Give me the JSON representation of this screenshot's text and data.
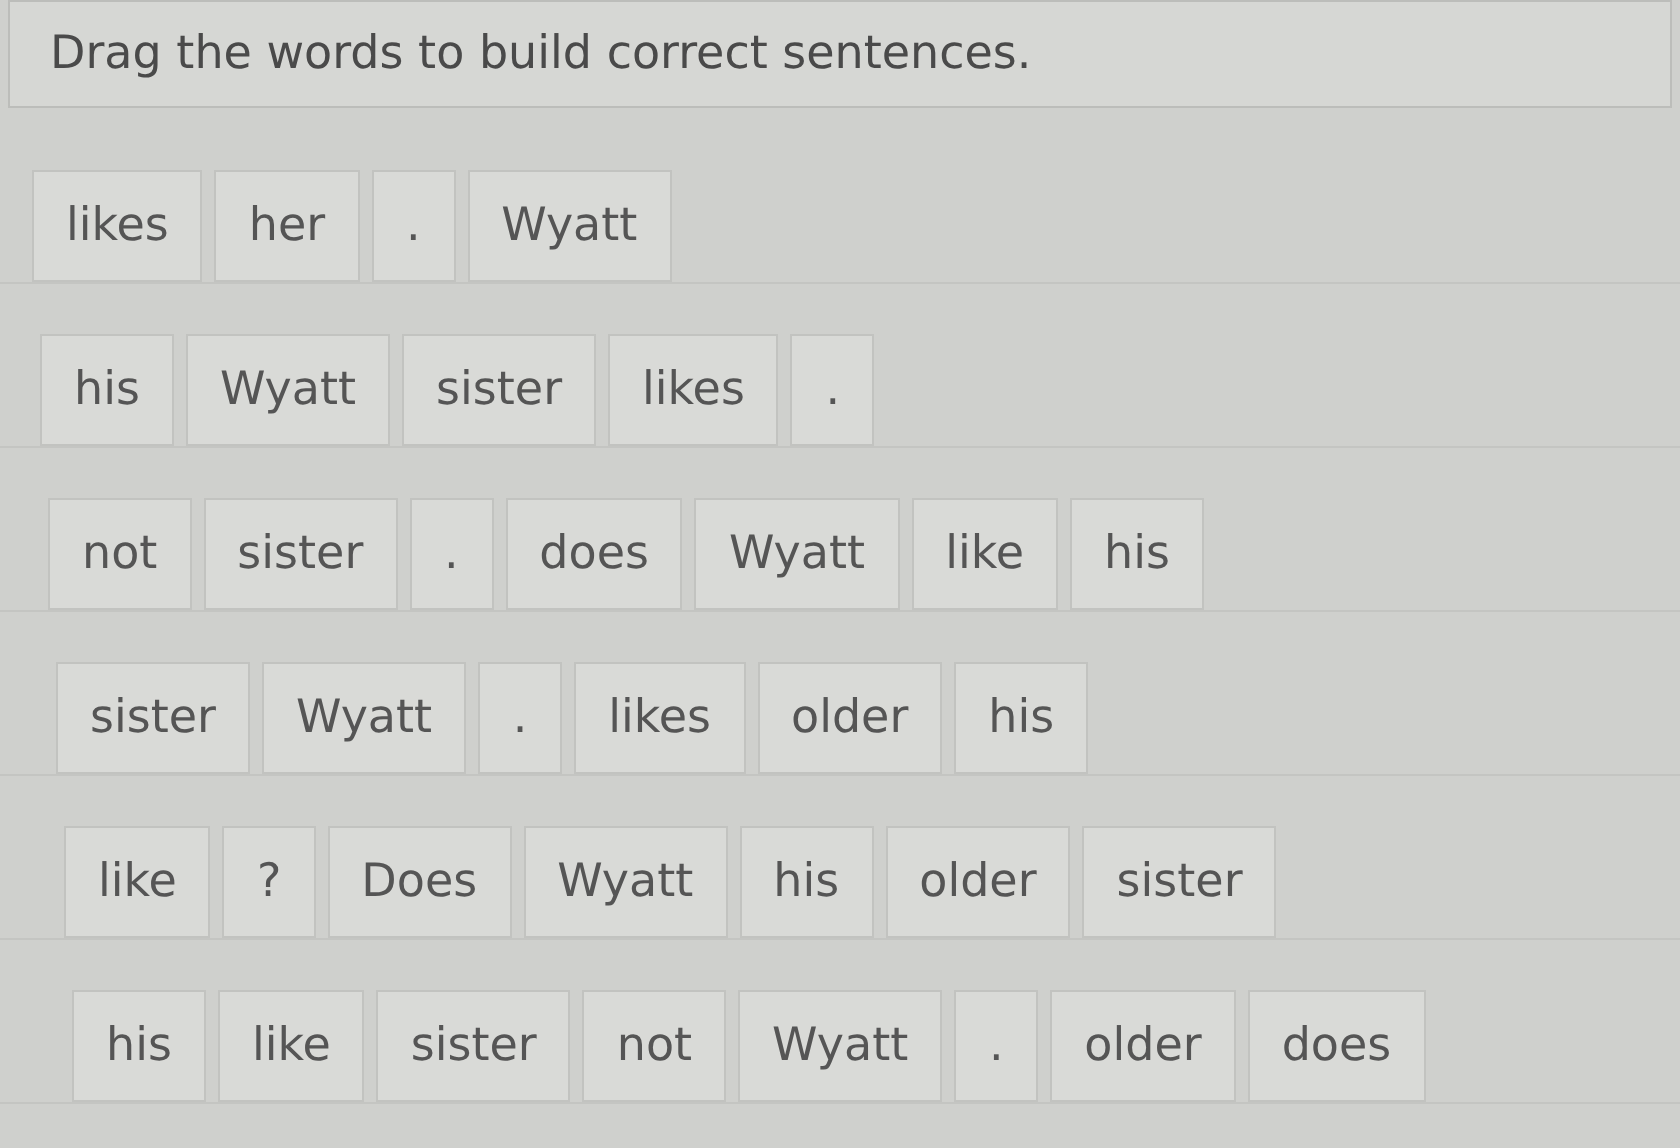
{
  "instruction": "Drag the words to build correct sentences.",
  "sentences": [
    {
      "words": [
        "likes",
        "her",
        ".",
        "Wyatt"
      ]
    },
    {
      "words": [
        "his",
        "Wyatt",
        "sister",
        "likes",
        "."
      ]
    },
    {
      "words": [
        "not",
        "sister",
        ".",
        "does",
        "Wyatt",
        "like",
        "his"
      ]
    },
    {
      "words": [
        "sister",
        "Wyatt",
        ".",
        "likes",
        "older",
        "his"
      ]
    },
    {
      "words": [
        "like",
        "?",
        "Does",
        "Wyatt",
        "his",
        "older",
        "sister"
      ]
    },
    {
      "words": [
        "his",
        "like",
        "sister",
        "not",
        "Wyatt",
        ".",
        "older",
        "does"
      ]
    }
  ]
}
